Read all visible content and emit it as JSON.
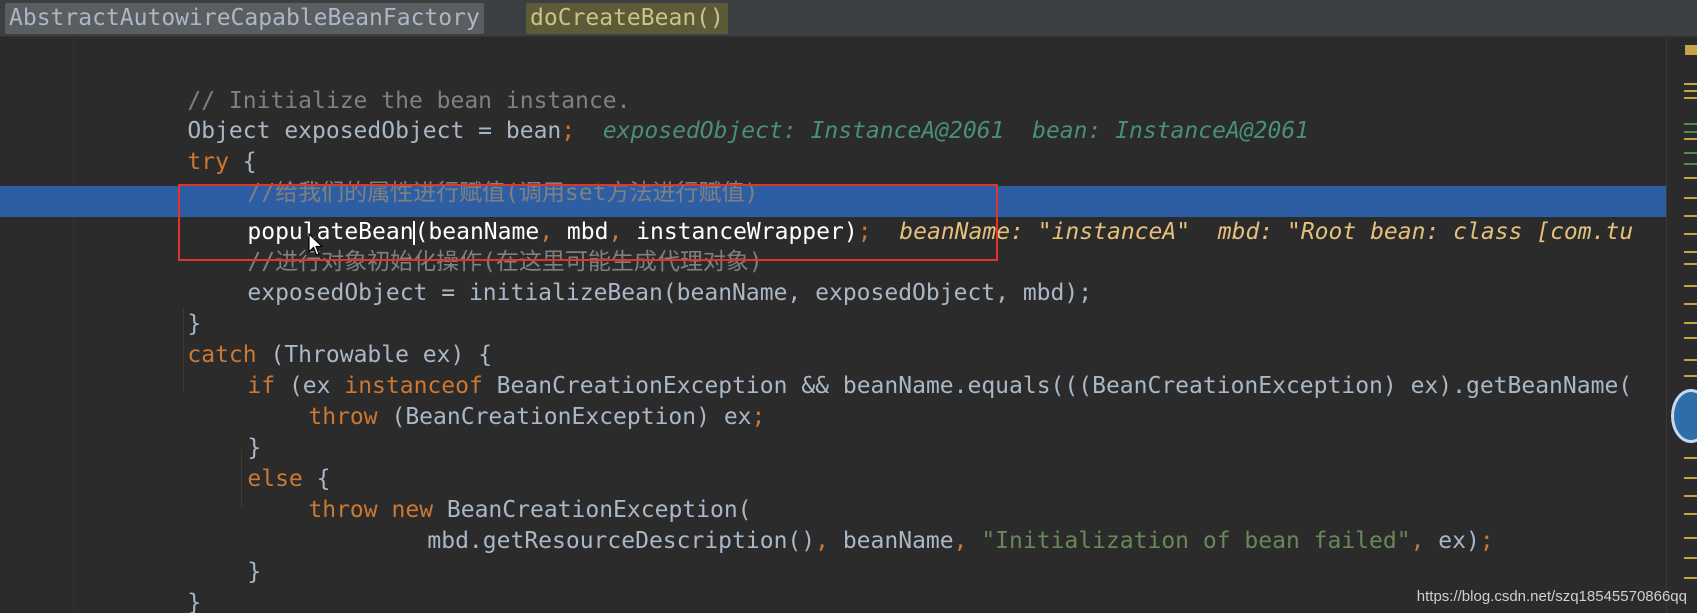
{
  "breadcrumb": {
    "class_name": "AbstractAutowireCapableBeanFactory",
    "method_name": "doCreateBean()"
  },
  "code": {
    "comment_init": "// Initialize the bean instance.",
    "exposed_decl": "Object exposedObject = bean",
    "exposed_semicolon": ";",
    "hint_exposed": "exposedObject: InstanceA@2061  bean: InstanceA@2061",
    "try_kw": "try",
    "brace_open": " {",
    "comment_populate": "//给我们的属性进行赋值(调用set方法进行赋值)",
    "populate_call_a": "populateBean",
    "populate_call_b": "(beanName",
    "populate_call_c": ", ",
    "populate_call_d": "mbd",
    "populate_call_e": ", ",
    "populate_call_f": "instanceWrapper)",
    "populate_semicolon": ";",
    "hint_populate": "beanName: \"instanceA\"  mbd: \"Root bean: class [com.tu",
    "comment_init_bean": "//进行对象初始化操作(在这里可能生成代理对象)",
    "init_bean_line": "exposedObject = initializeBean(beanName, exposedObject, mbd);",
    "close_brace": "}",
    "catch_kw": "catch",
    "catch_rest": " (Throwable ex) {",
    "if_kw": "if",
    "if_a": " (ex ",
    "instanceof_kw": "instanceof",
    "if_b": " BeanCreationException && beanName.equals(((BeanCreationException) ex).getBeanName(",
    "throw_kw": "throw",
    "throw_cast": " (BeanCreationException) ex",
    "semicolon": ";",
    "else_kw": "else",
    "else_rest": " {",
    "throw_new_kw": "new",
    "throw_new_rest": " BeanCreationException(",
    "args_a": "mbd.getResourceDescription()",
    "args_b": ", ",
    "args_c": "beanName",
    "args_d": ", ",
    "args_str": "\"Initialization of bean failed\"",
    "args_e": ", ",
    "args_f": "ex)",
    "args_semicolon": ";"
  },
  "watermark": "https://blog.csdn.net/szq18545570866qq",
  "colors": {
    "keyword": "#cc7832",
    "string": "#6a8759",
    "comment": "#808080",
    "selection": "#2d5ea3",
    "annotation_box": "#e0342c"
  }
}
